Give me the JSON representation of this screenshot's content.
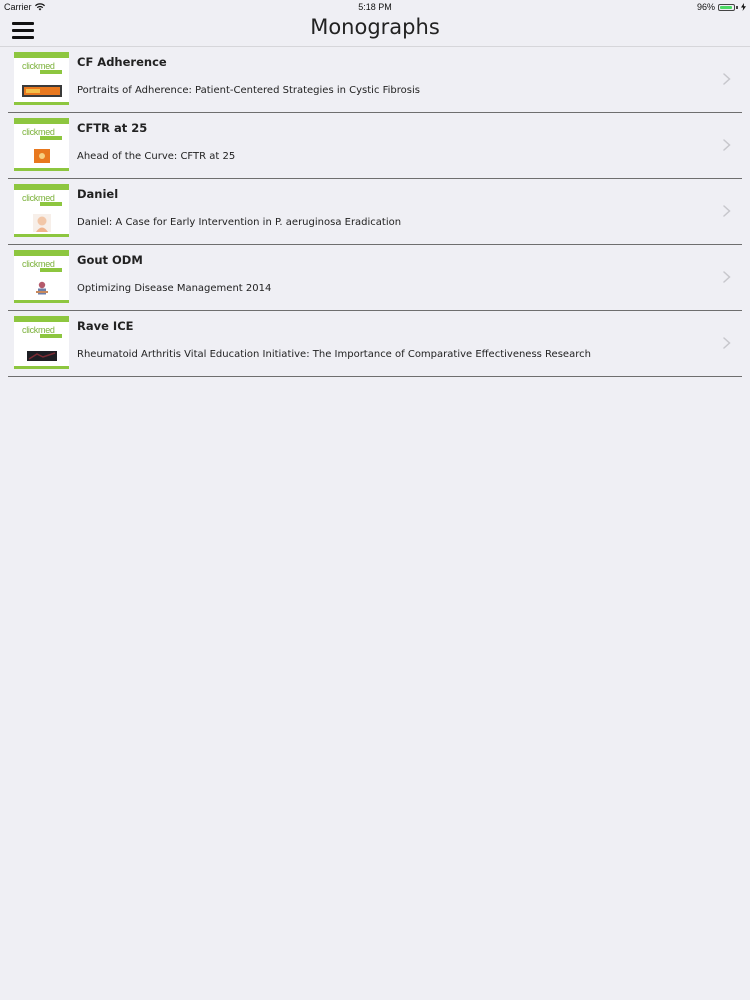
{
  "status_bar": {
    "carrier": "Carrier",
    "time": "5:18 PM",
    "battery_percent": "96%",
    "battery_level": 0.96
  },
  "nav": {
    "title": "Monographs",
    "menu_icon": "hamburger-menu-icon"
  },
  "thumbnail": {
    "logo_text": "clickmed",
    "accent_color": "#8dc63f"
  },
  "monographs": [
    {
      "title": "CF Adherence",
      "subtitle": "Portraits of Adherence: Patient-Centered Strategies in Cystic Fibrosis",
      "art": "orange-banner"
    },
    {
      "title": "CFTR at 25",
      "subtitle": "Ahead of the Curve: CFTR at 25",
      "art": "orange-square"
    },
    {
      "title": "Daniel",
      "subtitle": "Daniel: A Case for Early Intervention in P. aeruginosa Eradication",
      "art": "child-portrait"
    },
    {
      "title": "Gout ODM",
      "subtitle": "Optimizing Disease Management 2014",
      "art": "gout-figure"
    },
    {
      "title": "Rave ICE",
      "subtitle": "Rheumatoid Arthritis Vital Education Initiative: The Importance of Comparative Effectiveness Research",
      "art": "dark-banner"
    }
  ]
}
